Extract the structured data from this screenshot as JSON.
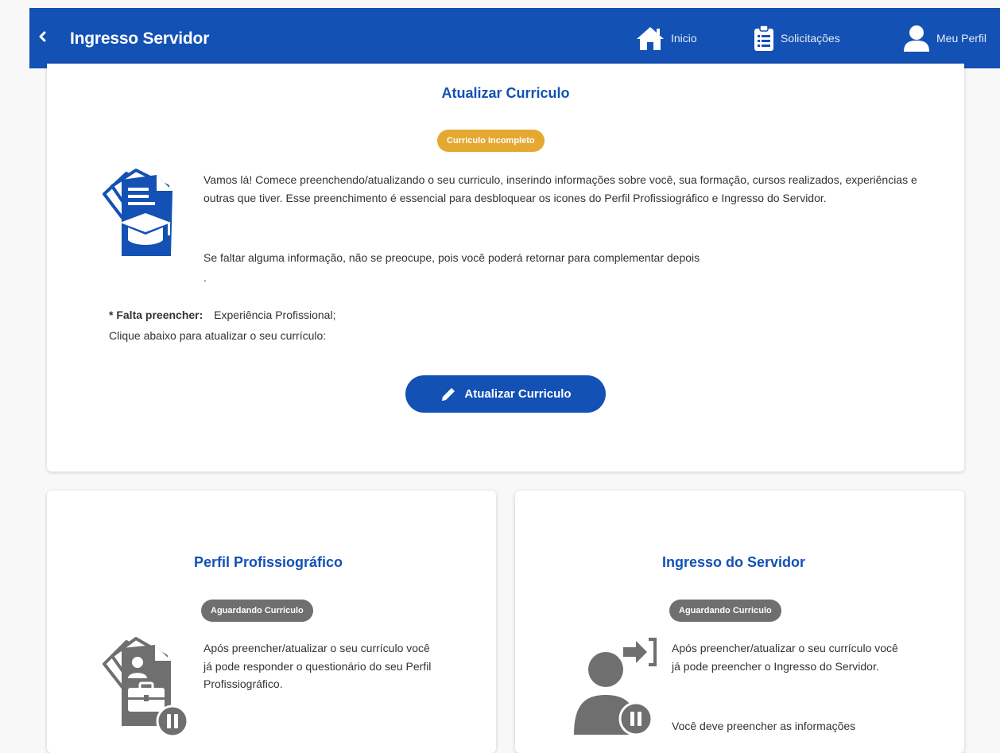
{
  "header": {
    "title": "Ingresso Servidor",
    "nav": {
      "home": "Inicio",
      "requests": "Solicitações",
      "profile": "Meu Perfil"
    }
  },
  "curriculum": {
    "title": "Atualizar Curriculo",
    "badge": "Curriculo Incompleto",
    "paragraph1": "Vamos lá! Comece preenchendo/atualizando o seu curriculo, inserindo informações sobre você, sua formação, cursos realizados, experiências e outras que tiver. Esse preenchimento é essencial para desbloquear os icones do Perfil Profissiográfico e Ingresso do Servidor.",
    "paragraph2": "Se faltar alguma informação, não se preocupe, pois você poderá retornar para complementar depois",
    "paragraph2_end": ".",
    "missing_label": "* Falta preencher:",
    "missing_value": "Experiência Profissional;",
    "click_hint": "Clique abaixo para atualizar o seu currículo:",
    "button_label": "Atualizar Curriculo",
    "icon": "curriculum-graduation-icon",
    "status_color": "#e5a831"
  },
  "professional_profile": {
    "title": "Perfil Profissiográfico",
    "badge": "Aguardando Curriculo",
    "text": "Após preencher/atualizar o seu currículo você já pode responder o questionário do seu Perfil Profissiográfico.",
    "icon": "profile-briefcase-paused-icon"
  },
  "server_entry": {
    "title": "Ingresso do Servidor",
    "badge": "Aguardando Curriculo",
    "text1": "Após preencher/atualizar o seu currículo você já pode preencher o Ingresso do Servidor.",
    "text2": "Você deve preencher as informações",
    "icon": "user-login-paused-icon"
  },
  "colors": {
    "primary": "#1351b4",
    "warning": "#e5a831",
    "disabled": "#6f6f6f"
  }
}
